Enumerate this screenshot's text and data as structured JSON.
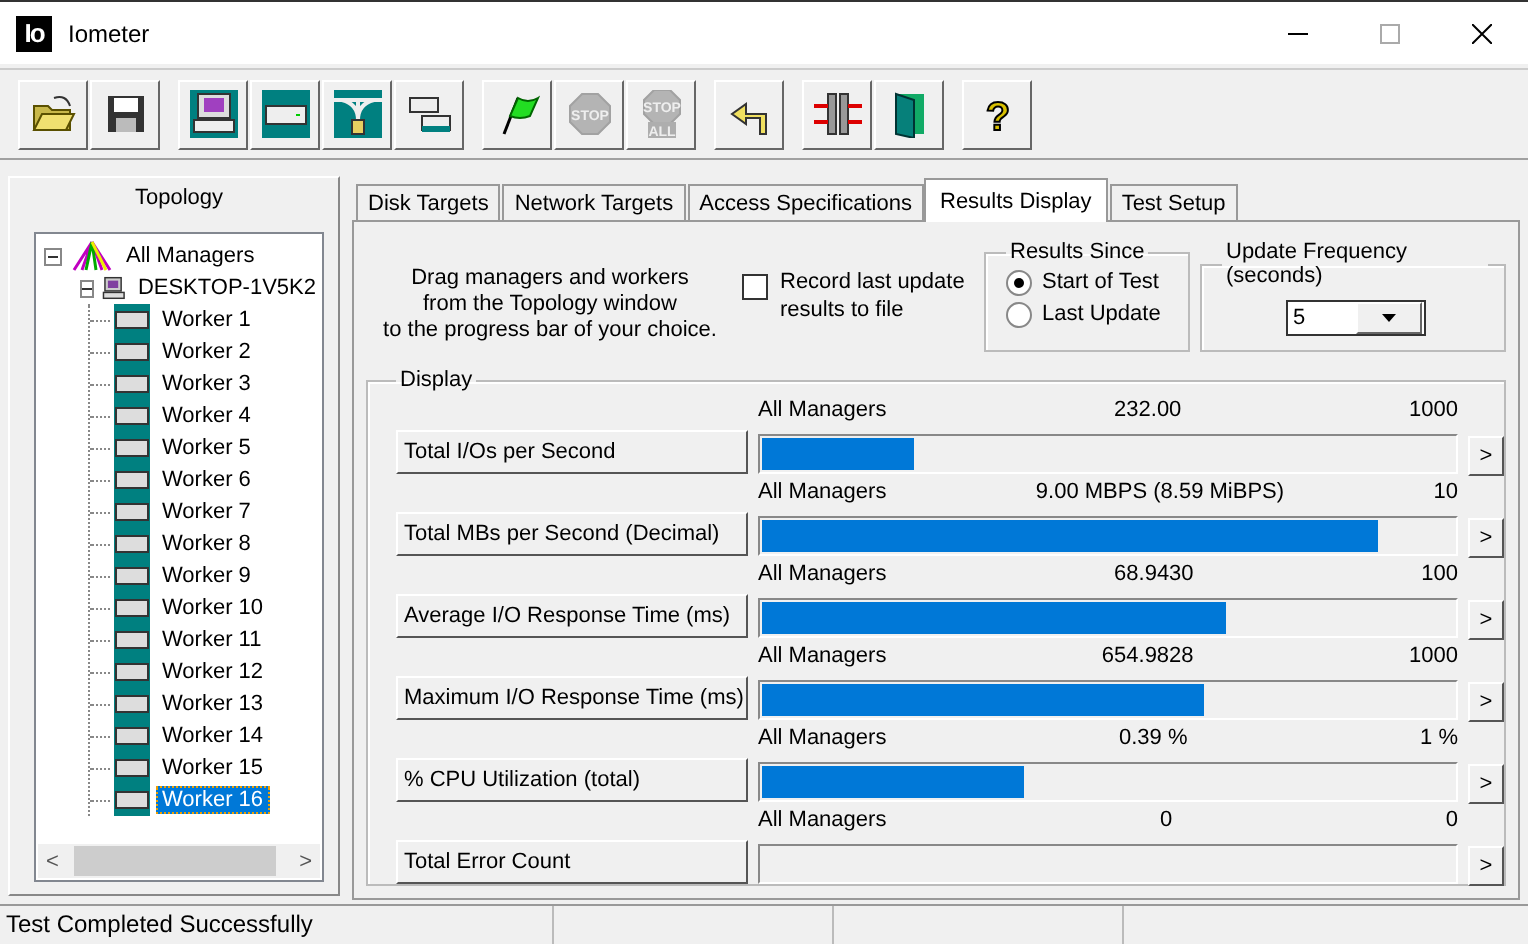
{
  "window": {
    "logo": "Io",
    "title": "Iometer"
  },
  "toolbar": [
    {
      "kind": "open",
      "disabled": false
    },
    {
      "kind": "save",
      "disabled": false
    },
    {
      "kind": "manager",
      "disabled": false
    },
    {
      "kind": "disk-worker",
      "disabled": false
    },
    {
      "kind": "network-worker",
      "disabled": false
    },
    {
      "kind": "copy-worker",
      "disabled": false
    },
    {
      "kind": "start",
      "disabled": false
    },
    {
      "kind": "stop",
      "disabled": true,
      "label": "STOP"
    },
    {
      "kind": "stop-all",
      "disabled": true,
      "label": "STOP",
      "sublabel": "ALL"
    },
    {
      "kind": "reset",
      "disabled": false
    },
    {
      "kind": "exit-workers",
      "disabled": false
    },
    {
      "kind": "exit",
      "disabled": false
    },
    {
      "kind": "help",
      "disabled": false,
      "label": "?"
    }
  ],
  "topology": {
    "title": "Topology",
    "tree": [
      {
        "label": "All Managers",
        "kind": "managers",
        "expanded": true,
        "selected": false,
        "children": [
          {
            "label": "DESKTOP-1V5K2",
            "kind": "manager",
            "expanded": true,
            "selected": false,
            "children": [
              {
                "label": "Worker 1",
                "kind": "worker",
                "selected": false
              },
              {
                "label": "Worker 2",
                "kind": "worker",
                "selected": false
              },
              {
                "label": "Worker 3",
                "kind": "worker",
                "selected": false
              },
              {
                "label": "Worker 4",
                "kind": "worker",
                "selected": false
              },
              {
                "label": "Worker 5",
                "kind": "worker",
                "selected": false
              },
              {
                "label": "Worker 6",
                "kind": "worker",
                "selected": false
              },
              {
                "label": "Worker 7",
                "kind": "worker",
                "selected": false
              },
              {
                "label": "Worker 8",
                "kind": "worker",
                "selected": false
              },
              {
                "label": "Worker 9",
                "kind": "worker",
                "selected": false
              },
              {
                "label": "Worker 10",
                "kind": "worker",
                "selected": false
              },
              {
                "label": "Worker 11",
                "kind": "worker",
                "selected": false
              },
              {
                "label": "Worker 12",
                "kind": "worker",
                "selected": false
              },
              {
                "label": "Worker 13",
                "kind": "worker",
                "selected": false
              },
              {
                "label": "Worker 14",
                "kind": "worker",
                "selected": false
              },
              {
                "label": "Worker 15",
                "kind": "worker",
                "selected": false
              },
              {
                "label": "Worker 16",
                "kind": "worker",
                "selected": true
              }
            ]
          }
        ]
      }
    ],
    "scroll_left": "<",
    "scroll_right": ">"
  },
  "tabs": [
    {
      "label": "Disk Targets",
      "selected": false
    },
    {
      "label": "Network Targets",
      "selected": false
    },
    {
      "label": "Access Specifications",
      "selected": false
    },
    {
      "label": "Results Display",
      "selected": true
    },
    {
      "label": "Test Setup",
      "selected": false
    }
  ],
  "results": {
    "instructions": "Drag managers and workers\nfrom the Topology window\nto the progress bar of your choice.",
    "record": {
      "label": "Record last update results to file",
      "checked": false
    },
    "results_since": {
      "title": "Results Since",
      "options": [
        {
          "label": "Start of Test",
          "selected": true
        },
        {
          "label": "Last Update",
          "selected": false
        }
      ]
    },
    "update_frequency": {
      "title": "Update Frequency (seconds)",
      "value": "5"
    },
    "display": {
      "title": "Display",
      "rows": [
        {
          "label": "Total I/Os per Second",
          "source": "All Managers",
          "value": "232.00",
          "max": "1000",
          "level": 0.22,
          "arrow": ">"
        },
        {
          "label": "Total MBs per Second (Decimal)",
          "source": "All Managers",
          "value": "9.00 MBPS (8.59 MiBPS)",
          "max": "10",
          "level": 0.89,
          "arrow": ">"
        },
        {
          "label": "Average I/O Response Time (ms)",
          "source": "All Managers",
          "value": "68.9430",
          "max": "100",
          "level": 0.67,
          "arrow": ">"
        },
        {
          "label": "Maximum I/O Response Time (ms)",
          "source": "All Managers",
          "value": "654.9828",
          "max": "1000",
          "level": 0.64,
          "arrow": ">"
        },
        {
          "label": "% CPU Utilization (total)",
          "source": "All Managers",
          "value": "0.39 %",
          "max": "1 %",
          "level": 0.38,
          "arrow": ">"
        },
        {
          "label": "Total Error Count",
          "source": "All Managers",
          "value": "0",
          "max": "0",
          "level": 0,
          "arrow": ">"
        }
      ]
    }
  },
  "status_bar": [
    "Test Completed Successfully"
  ]
}
